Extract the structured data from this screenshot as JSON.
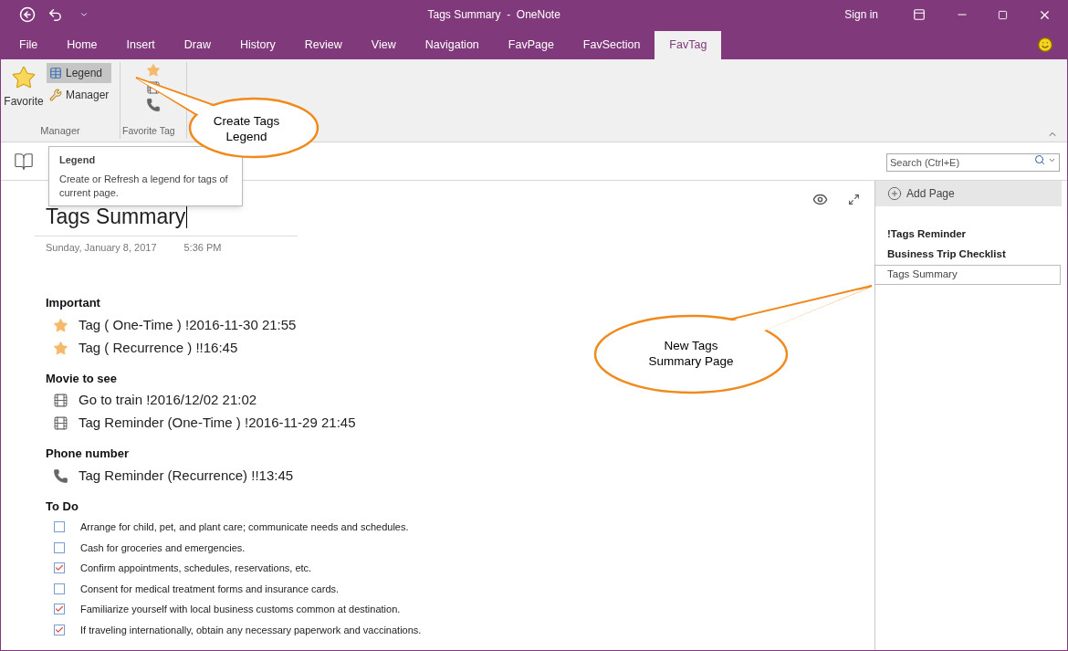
{
  "window": {
    "title": "Tags Summary  -  OneNote",
    "sign_in": "Sign in"
  },
  "tabs": [
    {
      "label": "File",
      "selected": false
    },
    {
      "label": "Home",
      "selected": false
    },
    {
      "label": "Insert",
      "selected": false
    },
    {
      "label": "Draw",
      "selected": false
    },
    {
      "label": "History",
      "selected": false
    },
    {
      "label": "Review",
      "selected": false
    },
    {
      "label": "View",
      "selected": false
    },
    {
      "label": "Navigation",
      "selected": false
    },
    {
      "label": "FavPage",
      "selected": false
    },
    {
      "label": "FavSection",
      "selected": false
    },
    {
      "label": "FavTag",
      "selected": true
    }
  ],
  "ribbon": {
    "manager_group": {
      "label": "Manager",
      "favorite": "Favorite",
      "buttons": [
        {
          "label": "Legend",
          "kind": "legend",
          "highlighted": true
        },
        {
          "label": "Manager",
          "kind": "manager",
          "highlighted": false
        }
      ]
    },
    "favorite_tag_group": {
      "label": "Favorite Tag",
      "icons": [
        {
          "kind": "star"
        },
        {
          "kind": "film"
        },
        {
          "kind": "phone"
        }
      ]
    }
  },
  "tooltip": {
    "title": "Legend",
    "text": "Create or Refresh a legend for tags of current page."
  },
  "search": {
    "placeholder": "Search (Ctrl+E)"
  },
  "page": {
    "title": "Tags Summary",
    "date": "Sunday, January 8, 2017",
    "time": "5:36 PM",
    "sections": [
      {
        "heading": "Important",
        "items": [
          {
            "kind": "star",
            "text": "Tag ( One-Time ) !2016-11-30 21:55"
          },
          {
            "kind": "star",
            "text": "Tag ( Recurrence ) !!16:45"
          }
        ]
      },
      {
        "heading": "Movie to see",
        "items": [
          {
            "kind": "film",
            "text": "Go to train !2016/12/02 21:02"
          },
          {
            "kind": "film",
            "text": "Tag Reminder (One-Time ) !2016-11-29 21:45"
          }
        ]
      },
      {
        "heading": "Phone number",
        "items": [
          {
            "kind": "phone",
            "text": "Tag Reminder (Recurrence) !!13:45"
          }
        ]
      },
      {
        "heading": "To Do",
        "items": [
          {
            "kind": "todo",
            "checked": false,
            "text": "Arrange for child, pet, and plant care; communicate needs and schedules."
          },
          {
            "kind": "todo",
            "checked": false,
            "text": "Cash for groceries and emergencies."
          },
          {
            "kind": "todo",
            "checked": true,
            "text": "Confirm appointments, schedules, reservations, etc."
          },
          {
            "kind": "todo",
            "checked": false,
            "text": "Consent for medical treatment forms and insurance cards."
          },
          {
            "kind": "todo",
            "checked": true,
            "text": "Familiarize yourself with local business customs common at destination."
          },
          {
            "kind": "todo",
            "checked": true,
            "text": "If traveling internationally, obtain any necessary paperwork and vaccinations."
          }
        ]
      }
    ]
  },
  "page_list": {
    "add_page": "Add Page",
    "pages": [
      {
        "title": "!Tags Reminder",
        "selected": false
      },
      {
        "title": "Business Trip Checklist",
        "selected": false
      },
      {
        "title": "Tags Summary",
        "selected": true
      }
    ]
  },
  "callouts": [
    {
      "text": "Create Tags Legend"
    },
    {
      "text": "New Tags Summary Page"
    }
  ]
}
